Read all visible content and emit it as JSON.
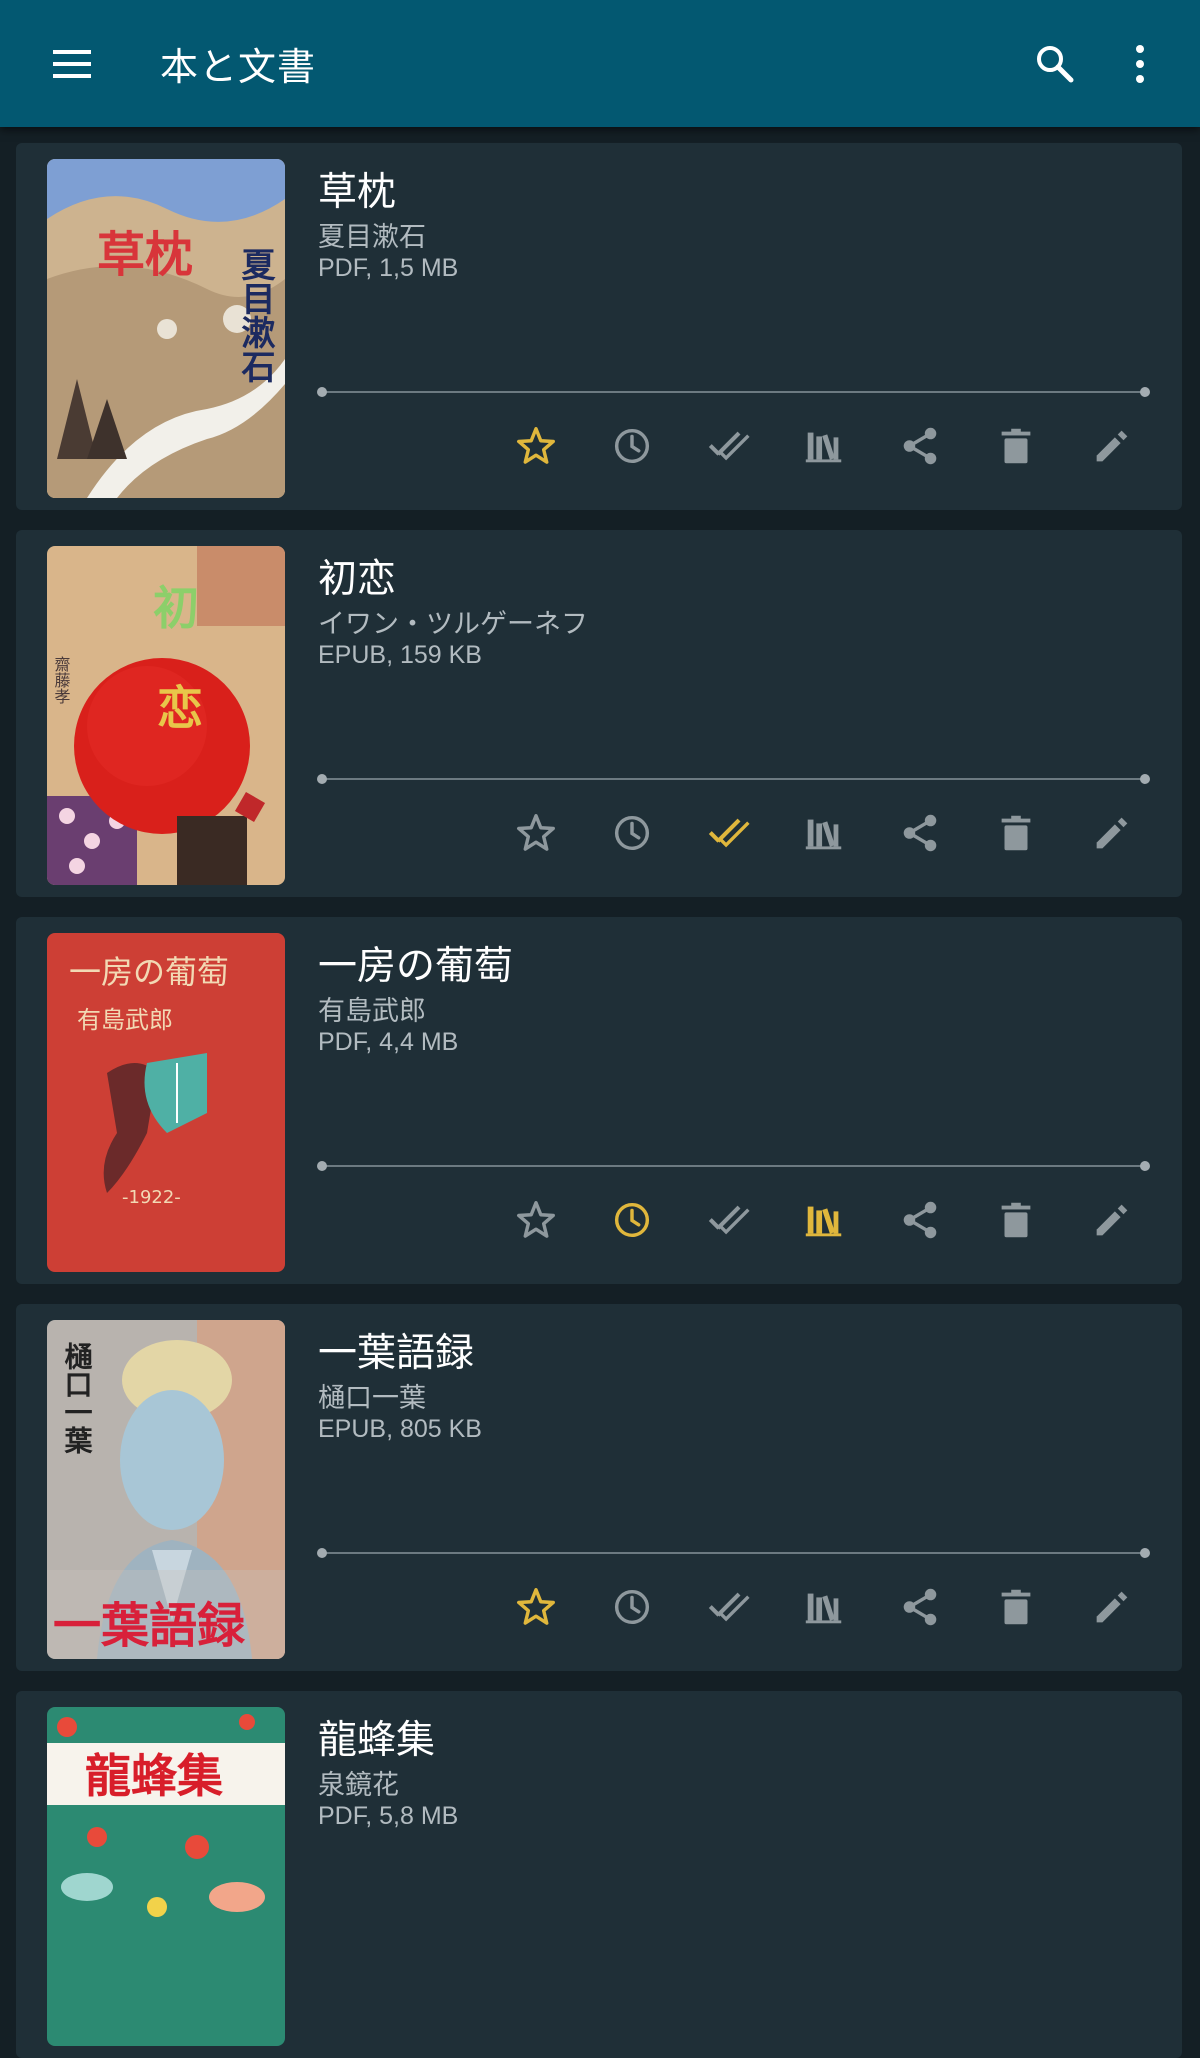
{
  "appbar": {
    "title": "本と文書",
    "icons": [
      "menu-icon",
      "search-icon",
      "more-vert-icon"
    ]
  },
  "colors": {
    "appbar": "#035871",
    "background": "#141f25",
    "card": "#1f2f37",
    "icon_inactive": "#8e989d",
    "icon_active": "#e0b73c"
  },
  "books": [
    {
      "title": "草枕",
      "author": "夏目漱石",
      "meta": "PDF, 1,5 MB",
      "cover_text": [
        "草枕",
        "夏目漱石"
      ],
      "favorite": true,
      "to_read": false,
      "finished": false,
      "in_collection": false
    },
    {
      "title": "初恋",
      "author": "イワン・ツルゲーネフ",
      "meta": "EPUB, 159 KB",
      "cover_text": [
        "初恋",
        "齋藤孝"
      ],
      "favorite": false,
      "to_read": false,
      "finished": true,
      "in_collection": false
    },
    {
      "title": "一房の葡萄",
      "author": "有島武郎",
      "meta": "PDF, 4,4 MB",
      "cover_text": [
        "一房の葡萄",
        "有島武郎",
        "-1922-"
      ],
      "favorite": false,
      "to_read": true,
      "finished": false,
      "in_collection": true
    },
    {
      "title": "一葉語録",
      "author": "樋口一葉",
      "meta": "EPUB, 805 KB",
      "cover_text": [
        "樋口一葉",
        "一葉語録"
      ],
      "favorite": true,
      "to_read": false,
      "finished": false,
      "in_collection": false
    },
    {
      "title": "龍蜂集",
      "author": "泉鏡花",
      "meta": "PDF, 5,8 MB",
      "cover_text": [
        "龍蜂集"
      ],
      "favorite": false,
      "to_read": false,
      "finished": false,
      "in_collection": false
    }
  ],
  "action_icons": [
    "star-icon",
    "clock-icon",
    "done-all-icon",
    "library-icon",
    "share-icon",
    "delete-icon",
    "edit-icon"
  ]
}
